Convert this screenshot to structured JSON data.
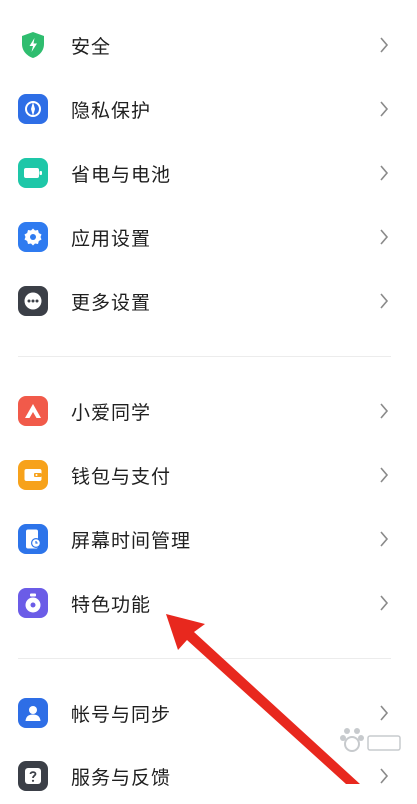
{
  "settings": {
    "items": [
      {
        "key": "security",
        "label": "安全",
        "icon": "shield-icon",
        "color": "#2fbd6f"
      },
      {
        "key": "privacy",
        "label": "隐私保护",
        "icon": "privacy-icon",
        "color": "#2e6ee6"
      },
      {
        "key": "battery",
        "label": "省电与电池",
        "icon": "battery-icon",
        "color": "#1ec7a8"
      },
      {
        "key": "apps",
        "label": "应用设置",
        "icon": "gear-icon",
        "color": "#2f7bf0"
      },
      {
        "key": "more",
        "label": "更多设置",
        "icon": "more-dots-icon",
        "color": "#3b3f47"
      },
      {
        "key": "xiaoai",
        "label": "小爱同学",
        "icon": "xiaoai-icon",
        "color": "#f15a4a"
      },
      {
        "key": "wallet",
        "label": "钱包与支付",
        "icon": "wallet-icon",
        "color": "#f7a21b"
      },
      {
        "key": "screentime",
        "label": "屏幕时间管理",
        "icon": "screen-time-icon",
        "color": "#2d74ea"
      },
      {
        "key": "special",
        "label": "特色功能",
        "icon": "special-features-icon",
        "color": "#6b5ce7"
      },
      {
        "key": "account",
        "label": "帐号与同步",
        "icon": "account-icon",
        "color": "#2e6ee6"
      },
      {
        "key": "service",
        "label": "服务与反馈",
        "icon": "feedback-icon",
        "color": "#3b3f47"
      }
    ]
  },
  "annotation": {
    "arrow_color": "#e8281e"
  }
}
